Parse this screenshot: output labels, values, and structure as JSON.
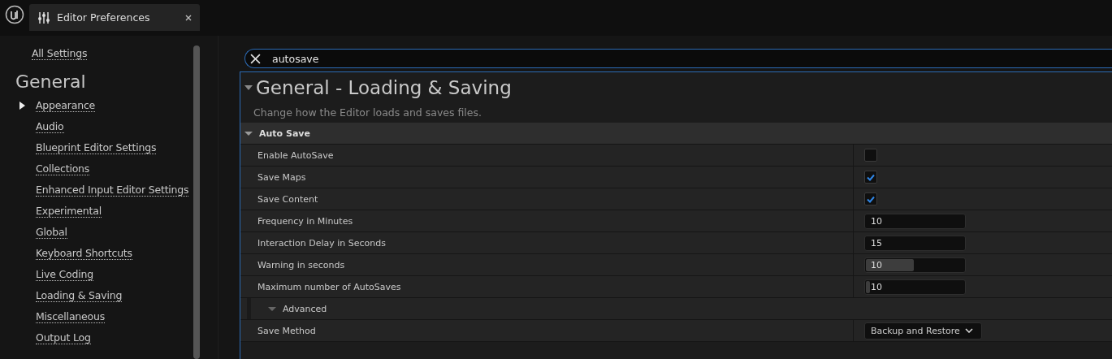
{
  "tab": {
    "title": "Editor Preferences"
  },
  "sidebar": {
    "all_settings": "All Settings",
    "section": "General",
    "items": [
      {
        "label": "Appearance",
        "selected": true
      },
      {
        "label": "Audio",
        "selected": false
      },
      {
        "label": "Blueprint Editor Settings",
        "selected": false
      },
      {
        "label": "Collections",
        "selected": false
      },
      {
        "label": "Enhanced Input Editor Settings",
        "selected": false
      },
      {
        "label": "Experimental",
        "selected": false
      },
      {
        "label": "Global",
        "selected": false
      },
      {
        "label": "Keyboard Shortcuts",
        "selected": false
      },
      {
        "label": "Live Coding",
        "selected": false
      },
      {
        "label": "Loading & Saving",
        "selected": false
      },
      {
        "label": "Miscellaneous",
        "selected": false
      },
      {
        "label": "Output Log",
        "selected": false
      }
    ]
  },
  "search": {
    "value": "autosave"
  },
  "panel": {
    "title": "General - Loading & Saving",
    "description": "Change how the Editor loads and saves files.",
    "category": "Auto Save",
    "expanded": true,
    "rows": [
      {
        "kind": "checkbox",
        "label": "Enable AutoSave",
        "checked": false
      },
      {
        "kind": "checkbox",
        "label": "Save Maps",
        "checked": true
      },
      {
        "kind": "checkbox",
        "label": "Save Content",
        "checked": true
      },
      {
        "kind": "number",
        "label": "Frequency in Minutes",
        "value": "10"
      },
      {
        "kind": "number",
        "label": "Interaction Delay in Seconds",
        "value": "15"
      },
      {
        "kind": "slider",
        "label": "Warning in seconds",
        "value": "10",
        "level": 0.48
      },
      {
        "kind": "slider",
        "label": "Maximum number of AutoSaves",
        "value": "10",
        "level": 0.03
      },
      {
        "kind": "group",
        "label": "Advanced",
        "expanded": true
      },
      {
        "kind": "dropdown",
        "label": "Save Method",
        "value": "Backup and Restore"
      }
    ]
  }
}
